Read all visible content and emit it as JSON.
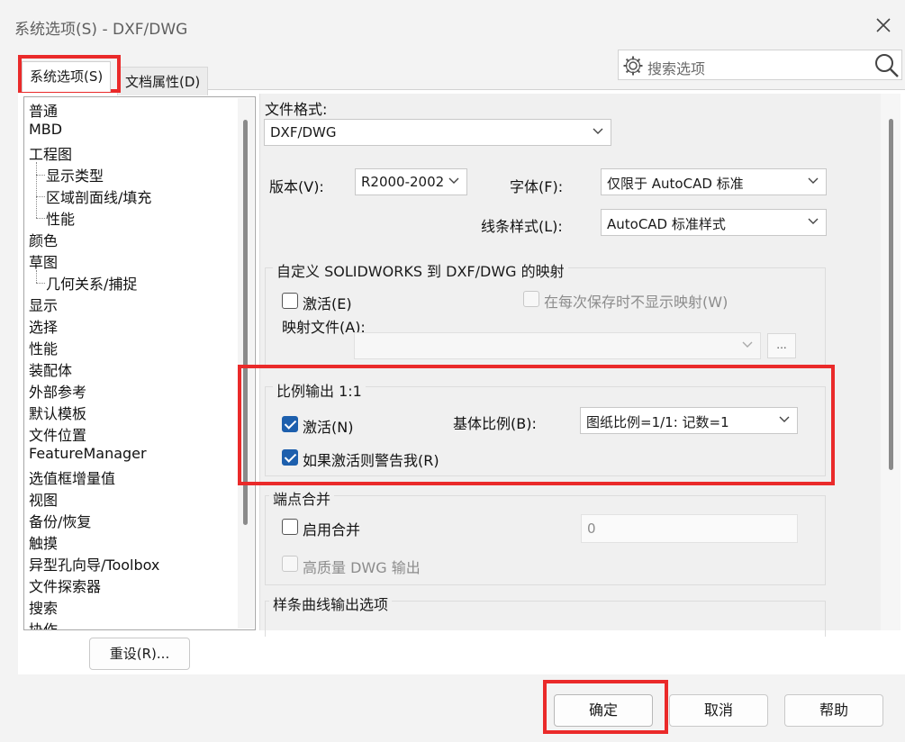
{
  "window": {
    "title": "系统选项(S) - DXF/DWG",
    "close_label": "✕"
  },
  "tabs": [
    {
      "label": "系统选项(S)",
      "active": true
    },
    {
      "label": "文档属性(D)",
      "active": false
    }
  ],
  "search": {
    "placeholder": "搜索选项"
  },
  "tree": {
    "items": [
      {
        "label": "普通",
        "level": 0
      },
      {
        "label": "MBD",
        "level": 0
      },
      {
        "label": "工程图",
        "level": 0
      },
      {
        "label": "显示类型",
        "level": 1
      },
      {
        "label": "区域剖面线/填充",
        "level": 1
      },
      {
        "label": "性能",
        "level": 1
      },
      {
        "label": "颜色",
        "level": 0
      },
      {
        "label": "草图",
        "level": 0
      },
      {
        "label": "几何关系/捕捉",
        "level": 1
      },
      {
        "label": "显示",
        "level": 0
      },
      {
        "label": "选择",
        "level": 0
      },
      {
        "label": "性能",
        "level": 0
      },
      {
        "label": "装配体",
        "level": 0
      },
      {
        "label": "外部参考",
        "level": 0
      },
      {
        "label": "默认模板",
        "level": 0
      },
      {
        "label": "文件位置",
        "level": 0
      },
      {
        "label": "FeatureManager",
        "level": 0
      },
      {
        "label": "选值框增量值",
        "level": 0
      },
      {
        "label": "视图",
        "level": 0
      },
      {
        "label": "备份/恢复",
        "level": 0
      },
      {
        "label": "触摸",
        "level": 0
      },
      {
        "label": "异型孔向导/Toolbox",
        "level": 0
      },
      {
        "label": "文件探索器",
        "level": 0
      },
      {
        "label": "搜索",
        "level": 0
      },
      {
        "label": "协作",
        "level": 0
      }
    ]
  },
  "reset_button": "重设(R)...",
  "format": {
    "label": "文件格式:",
    "value": "DXF/DWG"
  },
  "version": {
    "label": "版本(V):",
    "value": "R2000-2002"
  },
  "font": {
    "label": "字体(F):",
    "value": "仅限于 AutoCAD 标准"
  },
  "linestyle": {
    "label": "线条样式(L):",
    "value": "AutoCAD 标准样式"
  },
  "mapping": {
    "title": "自定义 SOLIDWORKS 到 DXF/DWG 的映射",
    "activate_label": "激活(E)",
    "activate_checked": false,
    "no_show_label": "在每次保存时不显示映射(W)",
    "no_show_checked": false,
    "file_label": "映射文件(A):",
    "file_value": "",
    "browse_label": "..."
  },
  "scale": {
    "title": "比例输出 1:1",
    "activate_label": "激活(N)",
    "activate_checked": true,
    "warn_label": "如果激活则警告我(R)",
    "warn_checked": true,
    "base_label": "基体比例(B):",
    "base_value": "图纸比例=1/1: 记数=1"
  },
  "merge": {
    "title": "端点合并",
    "enable_label": "启用合并",
    "enable_checked": false,
    "value": "0",
    "hq_label": "高质量 DWG 输出",
    "hq_checked": false
  },
  "spline": {
    "title": "样条曲线输出选项"
  },
  "footer": {
    "ok": "确定",
    "cancel": "取消",
    "help": "帮助"
  },
  "colors": {
    "highlight": "#ea2a2a",
    "checkbox_checked": "#1d5fad"
  }
}
